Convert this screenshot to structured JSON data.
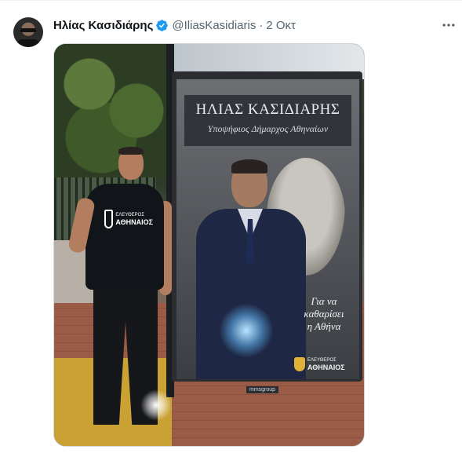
{
  "tweet": {
    "author_name": "Ηλίας Κασιδιάρης",
    "handle": "@IliasKasidiaris",
    "separator": "·",
    "time": "2 Οκτ",
    "verified": true
  },
  "icons": {
    "verified": "verified-badge-icon",
    "more": "more-options-icon"
  },
  "image": {
    "poster_title": "ΗΛΙΑΣ ΚΑΣΙΔΙΑΡΗΣ",
    "poster_subtitle": "Υποψήφιος Δήμαρχος Αθηναίων",
    "slogan_line1": "Για να",
    "slogan_line2": "καθαρίσει",
    "slogan_line3": "η Αθήνα",
    "logo_small": "ΕΛΕΥΘΕΡΟΣ",
    "logo_big": "ΑΘΗΝΑΙΟΣ",
    "shirt_small": "ΕΛΕΥΘΕΡΟΣ",
    "shirt_big": "ΑΘΗΝΑΙΟΣ",
    "kiosk_brand": "mmsgroup"
  },
  "colors": {
    "verified_blue": "#1d9bf0",
    "text_primary": "#0f1419",
    "text_secondary": "#536471",
    "border": "#cfd9de"
  }
}
